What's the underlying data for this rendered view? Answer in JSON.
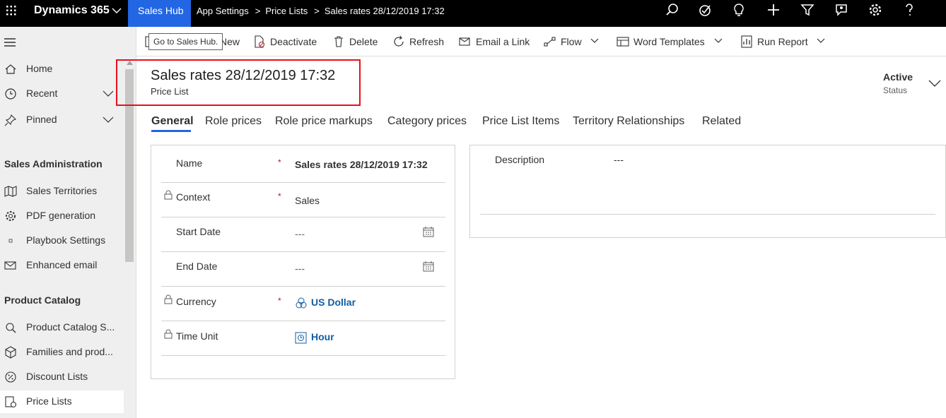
{
  "topbar": {
    "brand": "Dynamics 365",
    "app_tab": "Sales Hub",
    "breadcrumb": [
      "App Settings",
      "Price Lists",
      "Sales rates 28/12/2019 17:32"
    ],
    "icons": [
      "search-icon",
      "task-icon",
      "lightbulb-icon",
      "plus-icon",
      "filter-icon",
      "assistant-icon",
      "settings-icon",
      "help-icon",
      "user-icon"
    ]
  },
  "sidebar": {
    "top_items": [
      {
        "label": "Home",
        "icon": "home-icon"
      },
      {
        "label": "Recent",
        "icon": "clock-icon"
      },
      {
        "label": "Pinned",
        "icon": "pin-icon"
      }
    ],
    "groups": [
      {
        "title": "Sales Administration",
        "items": [
          {
            "label": "Sales Territories",
            "icon": "map-icon"
          },
          {
            "label": "PDF generation",
            "icon": "gear-icon"
          },
          {
            "label": "Playbook Settings",
            "icon": "dot-icon"
          },
          {
            "label": "Enhanced email",
            "icon": "mail-icon"
          }
        ]
      },
      {
        "title": "Product Catalog",
        "items": [
          {
            "label": "Product Catalog S...",
            "icon": "settings-icon"
          },
          {
            "label": "Families and prod...",
            "icon": "box-icon"
          },
          {
            "label": "Discount Lists",
            "icon": "percent-icon"
          },
          {
            "label": "Price Lists",
            "icon": "pricelist-icon"
          }
        ]
      }
    ]
  },
  "commands": {
    "new": "New",
    "deactivate": "Deactivate",
    "delete": "Delete",
    "refresh": "Refresh",
    "email_link": "Email a Link",
    "flow": "Flow",
    "word_templates": "Word Templates",
    "run_report": "Run Report"
  },
  "tooltip": "Go to Sales Hub.",
  "header": {
    "title": "Sales rates 28/12/2019 17:32",
    "entity": "Price List",
    "status_value": "Active",
    "status_label": "Status"
  },
  "tabs": [
    "General",
    "Role prices",
    "Role price markups",
    "Category prices",
    "Price List Items",
    "Territory Relationships",
    "Related"
  ],
  "form": {
    "name": {
      "label": "Name",
      "required": "*",
      "value": "Sales rates   28/12/2019 17:32"
    },
    "context": {
      "label": "Context",
      "required": "*",
      "value": "Sales"
    },
    "start_date": {
      "label": "Start Date",
      "value": "---"
    },
    "end_date": {
      "label": "End Date",
      "value": "---"
    },
    "currency": {
      "label": "Currency",
      "required": "*",
      "value": "US Dollar"
    },
    "time_unit": {
      "label": "Time Unit",
      "value": "Hour"
    }
  },
  "description": {
    "label": "Description",
    "value": "---"
  },
  "colors": {
    "topbar": "#000000",
    "app_tab": "#2266e3",
    "highlight_box": "#e8101b",
    "link": "#115ea3",
    "required": "#a4262c"
  }
}
